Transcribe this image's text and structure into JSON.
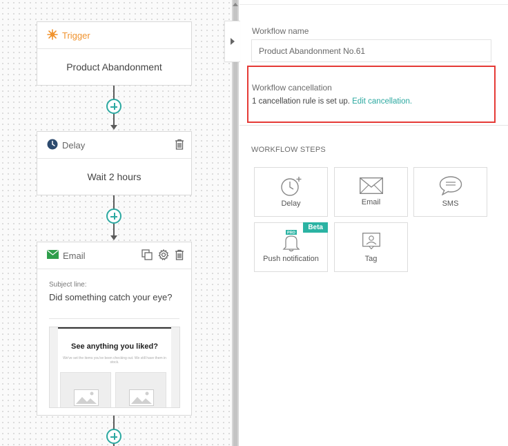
{
  "workflow": {
    "trigger": {
      "header": "Trigger",
      "body": "Product Abandonment"
    },
    "delay": {
      "header": "Delay",
      "body": "Wait 2 hours"
    },
    "email": {
      "header": "Email",
      "subject_label": "Subject line:",
      "subject": "Did something catch your eye?",
      "preview_title": "See anything you liked?",
      "preview_text": "We've set the items you've been checking out. We still have them in stock."
    }
  },
  "panel": {
    "name_label": "Workflow name",
    "name_value": "Product Abandonment No.61",
    "cancellation": {
      "label": "Workflow cancellation",
      "count": "1",
      "text": "cancellation rule is set up.",
      "link": "Edit cancellation."
    },
    "steps_title": "WORKFLOW STEPS",
    "steps": [
      {
        "label": "Delay",
        "icon": "clock-plus-icon"
      },
      {
        "label": "Email",
        "icon": "envelope-icon"
      },
      {
        "label": "SMS",
        "icon": "speech-bubble-icon"
      },
      {
        "label": "Push notification",
        "icon": "bell-pro-icon",
        "badge": "Beta",
        "icon_badge": "PRO"
      },
      {
        "label": "Tag",
        "icon": "tag-user-icon"
      }
    ]
  },
  "colors": {
    "accent": "#2ba8a0",
    "highlight_border": "#e53935",
    "trigger_orange": "#f0932e",
    "email_green": "#2e9e4b",
    "delay_navy": "#2c4a6e"
  }
}
